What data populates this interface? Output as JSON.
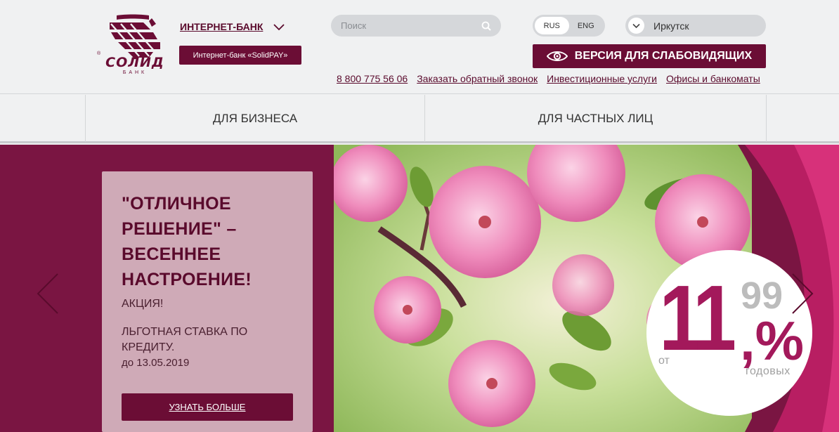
{
  "logo": {
    "name": "СОЛИД",
    "sub": "БАНК"
  },
  "header": {
    "internet_bank_label": "ИНТЕРНЕТ-БАНК",
    "solidpay_label": "Интернет-банк «SolidPAY»",
    "search_placeholder": "Поиск",
    "lang": [
      "RUS",
      "ENG"
    ],
    "lang_active": "RUS",
    "city": "Иркутск",
    "vision_label": "ВЕРСИЯ ДЛЯ СЛАБОВИДЯЩИХ",
    "links": [
      "8 800 775 56 06",
      "Заказать обратный звонок",
      "Инвестиционные услуги",
      "Офисы и банкоматы"
    ]
  },
  "nav": {
    "business": "ДЛЯ БИЗНЕСА",
    "private": "ДЛЯ ЧАСТНЫХ ЛИЦ"
  },
  "banner": {
    "title": "\"ОТЛИЧНОЕ РЕШЕНИЕ\" – ВЕСЕННЕЕ НАСТРОЕНИЕ!",
    "promo": "АКЦИЯ!",
    "desc": "ЛЬГОТНАЯ СТАВКА ПО КРЕДИТУ.",
    "date": "до 13.05.2019",
    "more_label": "УЗНАТЬ БОЛЬШЕ",
    "rate": {
      "prefix": "от",
      "whole": "11",
      "decimal": "99",
      "sign": ",%",
      "suffix": "годовых"
    }
  },
  "colors": {
    "brand": "#6b0d35",
    "accent": "#a3195b",
    "banner_bg": "#7a1542"
  },
  "icons": [
    "logo-icon",
    "chevron-down-icon",
    "search-icon",
    "eye-icon",
    "arrow-left-icon",
    "arrow-right-icon"
  ]
}
